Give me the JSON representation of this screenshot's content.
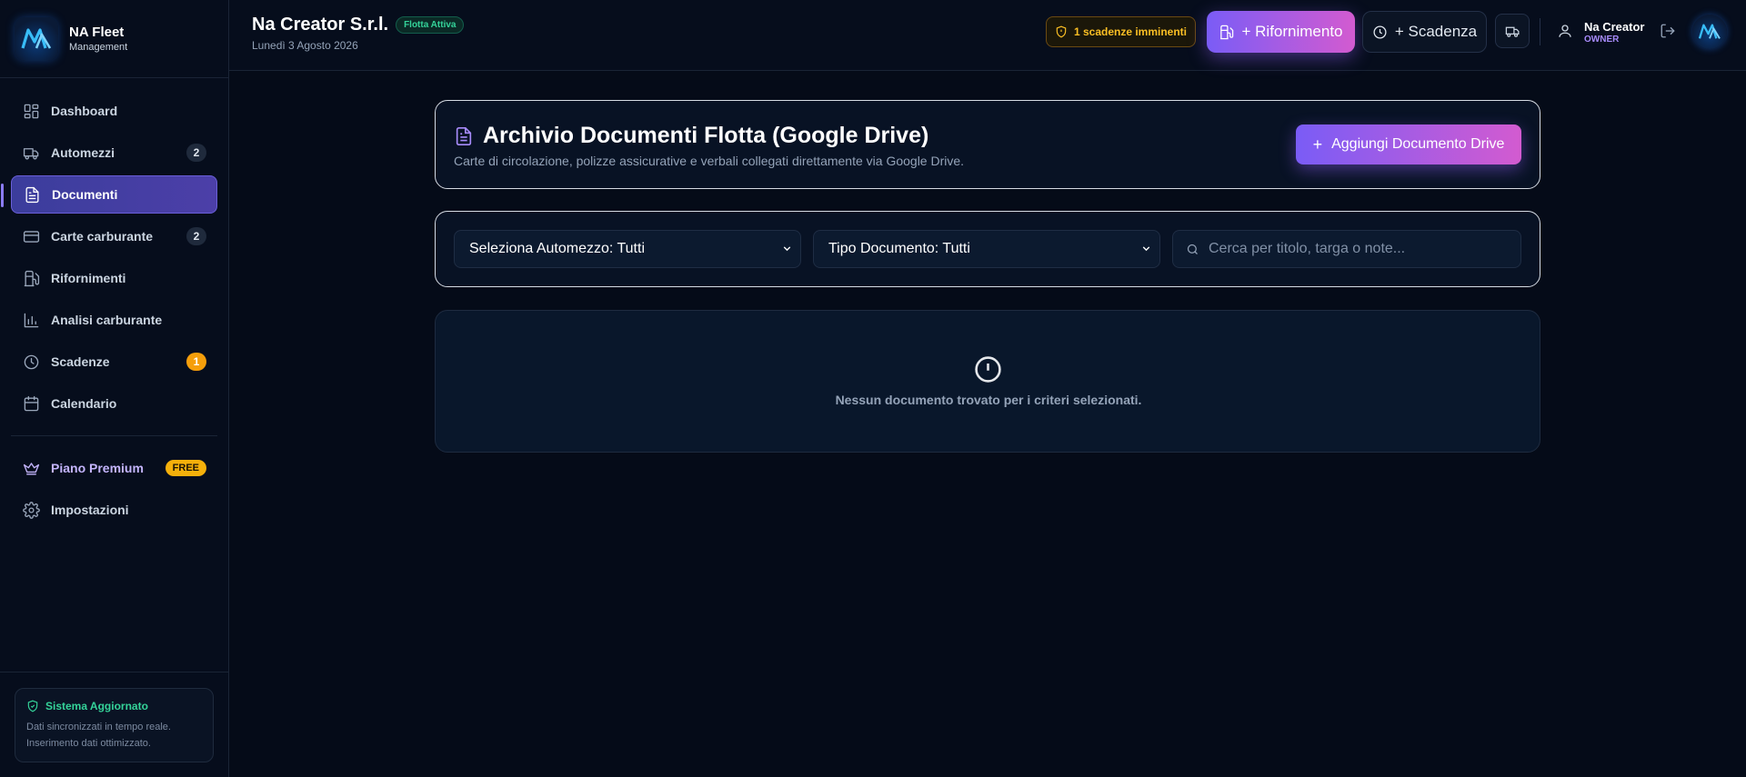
{
  "brand": {
    "title": "NA Fleet",
    "subtitle": "Management"
  },
  "sidebar": {
    "items": [
      {
        "label": "Dashboard",
        "icon": "dashboard-icon"
      },
      {
        "label": "Automezzi",
        "icon": "truck-icon",
        "badge": "2"
      },
      {
        "label": "Documenti",
        "icon": "document-icon",
        "active": true
      },
      {
        "label": "Carte carburante",
        "icon": "credit-card-icon",
        "badge": "2"
      },
      {
        "label": "Rifornimenti",
        "icon": "fuel-icon"
      },
      {
        "label": "Analisi carburante",
        "icon": "bar-chart-icon"
      },
      {
        "label": "Scadenze",
        "icon": "clock-icon",
        "badge": "1"
      },
      {
        "label": "Calendario",
        "icon": "calendar-icon"
      }
    ],
    "premium": {
      "label": "Piano Premium",
      "badge": "FREE",
      "icon": "crown-icon"
    },
    "settings": {
      "label": "Impostazioni",
      "icon": "gear-icon"
    },
    "system": {
      "title": "Sistema Aggiornato",
      "line1": "Dati sincronizzati in tempo reale.",
      "line2": "Inserimento dati ottimizzato."
    }
  },
  "header": {
    "company": "Na Creator S.r.l.",
    "status_badge": "Flotta Attiva",
    "date": "Lunedì 3 Agosto 2026",
    "alert": "1 scadenze imminenti",
    "refuel_button": "+ Rifornimento",
    "deadline_button": "+ Scadenza",
    "user": {
      "name": "Na Creator",
      "role": "OWNER"
    }
  },
  "main": {
    "title": "Archivio Documenti Flotta (Google Drive)",
    "subtitle": "Carte di circolazione, polizze assicurative e verbali collegati direttamente via Google Drive.",
    "add_button": "Aggiungi Documento Drive",
    "filters": {
      "vehicle_select": "Seleziona Automezzo: Tutti",
      "type_select": "Tipo Documento: Tutti",
      "search_placeholder": "Cerca per titolo, targa o note..."
    },
    "empty_message": "Nessun documento trovato per i criteri selezionati."
  },
  "colors": {
    "background": "#050b18",
    "accent_gradient_start": "#7a5cf6",
    "accent_gradient_end": "#d35bd0",
    "success": "#34d399",
    "warning": "#fbbf24"
  }
}
